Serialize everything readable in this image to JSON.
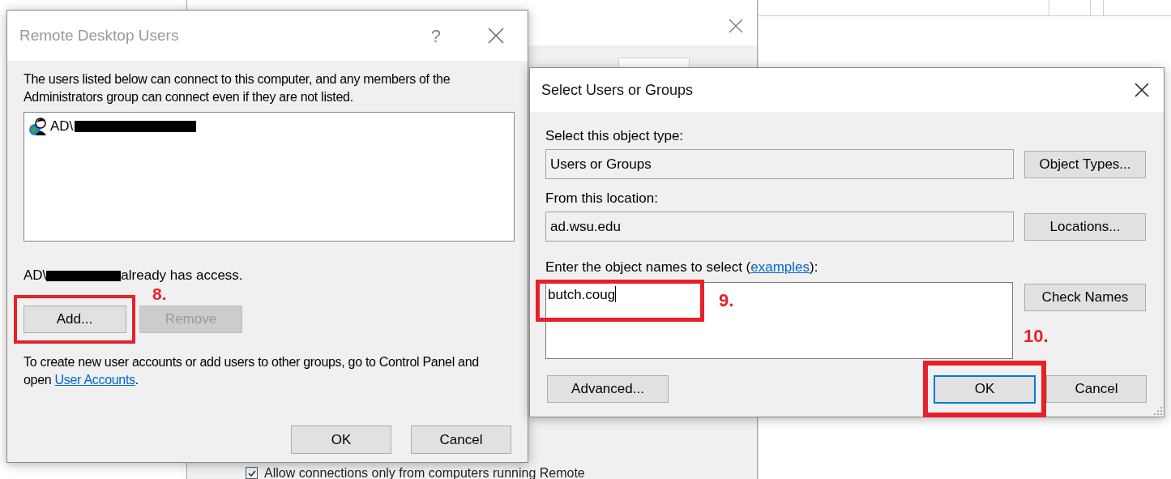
{
  "background_window": {
    "tab": {
      "selected": true
    },
    "checkbox": {
      "label": "Allow connections only from computers running Remote",
      "checked": true
    }
  },
  "remote_desktop_users": {
    "title": "Remote Desktop Users",
    "help": "?",
    "intro": "The users listed below can connect to this computer, and any members of the Administrators group can connect even if they are not listed.",
    "users": [
      {
        "name": "AD\\",
        "redacted": true
      }
    ],
    "access_note": {
      "prefix": "AD\\",
      "suffix": "already has access."
    },
    "buttons": [
      {
        "label": "Add...",
        "disabled": false,
        "highlighted": true
      },
      {
        "label": "Remove",
        "disabled": true,
        "highlighted": false
      }
    ],
    "info": {
      "text": "To create new user accounts or add users to other groups, go to Control Panel and open ",
      "link": "User Accounts",
      "end": "."
    },
    "footer_buttons": [
      {
        "label": "OK"
      },
      {
        "label": "Cancel"
      }
    ]
  },
  "select_users": {
    "title": "Select Users or Groups",
    "fields": [
      {
        "label": "Select this object type:",
        "value": "Users or Groups",
        "button": "Object Types..."
      },
      {
        "label": "From this location:",
        "value": "ad.wsu.edu",
        "button": "Locations..."
      }
    ],
    "names": {
      "label_before": "Enter the object names to select (",
      "link": "examples",
      "label_after": "):",
      "value": "butch.coug",
      "button": "Check Names"
    },
    "advanced": "Advanced...",
    "ok": {
      "label": "OK",
      "focused": true
    },
    "cancel": "Cancel"
  },
  "annotations": [
    {
      "label": "8."
    },
    {
      "label": "9."
    },
    {
      "label": "10."
    }
  ]
}
